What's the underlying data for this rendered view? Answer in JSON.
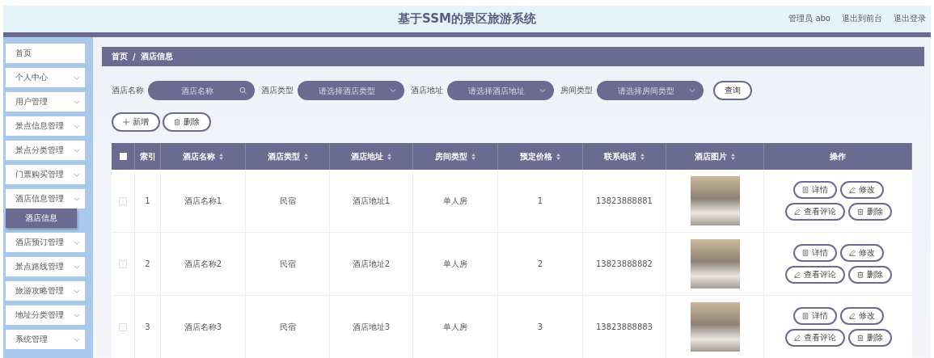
{
  "header": {
    "title": "基于SSM的景区旅游系统",
    "user": "管理员 abo",
    "links": [
      "退出到前台",
      "退出登录"
    ]
  },
  "sidebar": {
    "items": [
      {
        "label": "首页",
        "kind": "link"
      },
      {
        "label": "个人中心",
        "kind": "submenu"
      },
      {
        "label": "用户管理",
        "kind": "submenu"
      },
      {
        "label": "景点信息管理",
        "kind": "submenu"
      },
      {
        "label": "景点分类管理",
        "kind": "submenu"
      },
      {
        "label": "门票购买管理",
        "kind": "submenu"
      },
      {
        "label": "酒店信息管理",
        "kind": "submenu",
        "children": [
          {
            "label": "酒店信息",
            "selected": true
          }
        ]
      },
      {
        "label": "酒店预订管理",
        "kind": "submenu"
      },
      {
        "label": "景点路线管理",
        "kind": "submenu"
      },
      {
        "label": "旅游攻略管理",
        "kind": "submenu"
      },
      {
        "label": "地址分类管理",
        "kind": "submenu"
      },
      {
        "label": "系统管理",
        "kind": "submenu"
      }
    ]
  },
  "breadcrumb": [
    "首页",
    "/",
    "酒店信息"
  ],
  "filters": [
    {
      "label": "酒店名称",
      "placeholder": "酒店名称",
      "kind": "search"
    },
    {
      "label": "酒店类型",
      "placeholder": "请选择酒店类型",
      "kind": "select"
    },
    {
      "label": "酒店地址",
      "placeholder": "请选择酒店地址",
      "kind": "select"
    },
    {
      "label": "房间类型",
      "placeholder": "请选择房间类型",
      "kind": "select"
    }
  ],
  "query_button": "查询",
  "actions": [
    {
      "label": "新增",
      "kind": "add"
    },
    {
      "label": "删除",
      "kind": "delete"
    }
  ],
  "table": {
    "select_all_checked": false,
    "columns": [
      {
        "label": "索引",
        "sortable": false
      },
      {
        "label": "酒店名称",
        "sortable": true
      },
      {
        "label": "酒店类型",
        "sortable": true
      },
      {
        "label": "酒店地址",
        "sortable": true
      },
      {
        "label": "房间类型",
        "sortable": true
      },
      {
        "label": "预定价格",
        "sortable": true
      },
      {
        "label": "联系电话",
        "sortable": true
      },
      {
        "label": "酒店图片",
        "sortable": true
      },
      {
        "label": "操作",
        "sortable": false
      }
    ],
    "rows": [
      {
        "checked": false,
        "cells": [
          "1",
          "酒店名称1",
          "民宿",
          "酒店地址1",
          "单人房",
          "1",
          "13823888881"
        ],
        "actions": [
          {
            "label": "详情",
            "kind": "detail"
          },
          {
            "label": "修改",
            "kind": "edit"
          },
          {
            "label": "查看评论",
            "kind": "edit"
          },
          {
            "label": "删除",
            "kind": "delete"
          }
        ]
      },
      {
        "checked": false,
        "cells": [
          "2",
          "酒店名称2",
          "民宿",
          "酒店地址2",
          "单人房",
          "2",
          "13823888882"
        ],
        "actions": [
          {
            "label": "详情",
            "kind": "detail"
          },
          {
            "label": "修改",
            "kind": "edit"
          },
          {
            "label": "查看评论",
            "kind": "edit"
          },
          {
            "label": "删除",
            "kind": "delete"
          }
        ]
      },
      {
        "checked": false,
        "cells": [
          "3",
          "酒店名称3",
          "民宿",
          "酒店地址3",
          "单人房",
          "3",
          "13823888883"
        ],
        "actions": [
          {
            "label": "详情",
            "kind": "detail"
          },
          {
            "label": "修改",
            "kind": "edit"
          },
          {
            "label": "查看评论",
            "kind": "edit"
          },
          {
            "label": "删除",
            "kind": "delete"
          }
        ]
      }
    ]
  }
}
